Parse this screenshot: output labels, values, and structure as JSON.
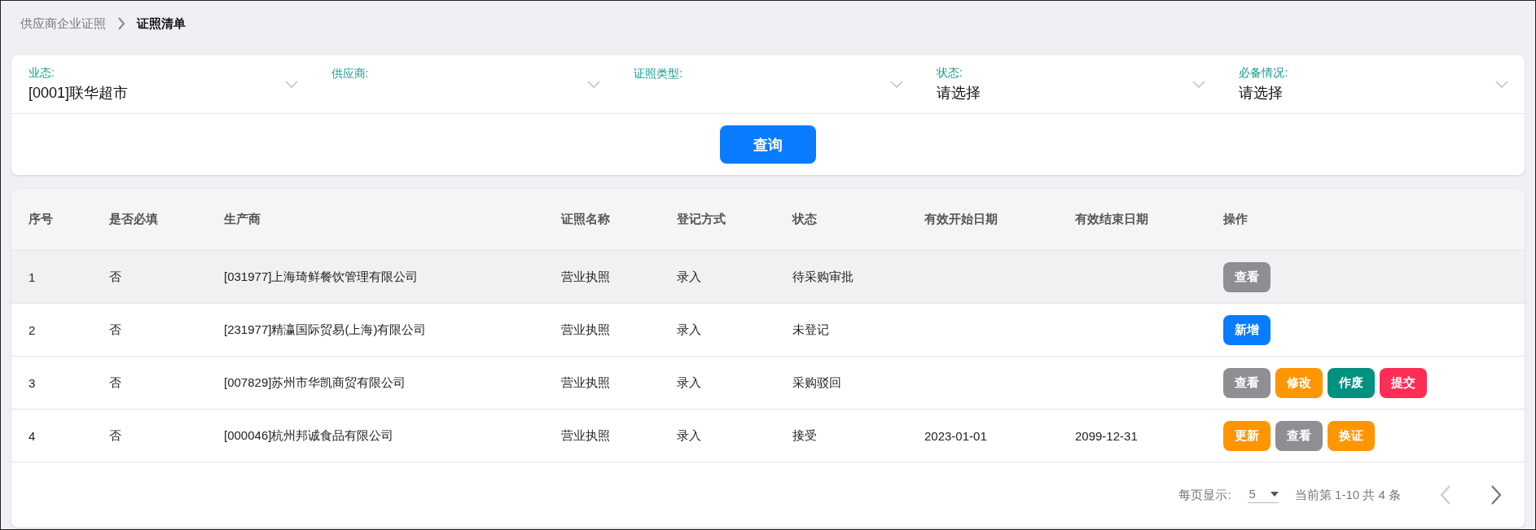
{
  "breadcrumb": [
    {
      "label": "供应商企业证照",
      "current": false
    },
    {
      "label": "证照清单",
      "current": true
    }
  ],
  "filters": [
    {
      "label": "业态:",
      "value": "[0001]联华超市"
    },
    {
      "label": "供应商:"
    },
    {
      "label": "证照类型:"
    },
    {
      "label": "状态:",
      "value": "请选择"
    },
    {
      "label": "必备情况:",
      "value": "请选择"
    }
  ],
  "query_button": "查询",
  "table": {
    "columns": [
      "序号",
      "是否必填",
      "生产商",
      "证照名称",
      "登记方式",
      "状态",
      "有效开始日期",
      "有效结束日期",
      "操作"
    ],
    "rows": [
      {
        "selected": true,
        "cells": [
          "1",
          "否",
          "[031977]上海琦鲜餐饮管理有限公司",
          "营业执照",
          "录入",
          "待采购审批",
          "",
          ""
        ],
        "actions": [
          {
            "label": "查看",
            "kind": "view"
          }
        ]
      },
      {
        "selected": false,
        "cells": [
          "2",
          "否",
          "[231977]精瀛国际贸易(上海)有限公司",
          "营业执照",
          "录入",
          "未登记",
          "",
          ""
        ],
        "actions": [
          {
            "label": "新增",
            "kind": "add"
          }
        ]
      },
      {
        "selected": false,
        "cells": [
          "3",
          "否",
          "[007829]苏州市华凯商贸有限公司",
          "营业执照",
          "录入",
          "采购驳回",
          "",
          ""
        ],
        "actions": [
          {
            "label": "查看",
            "kind": "view"
          },
          {
            "label": "修改",
            "kind": "edit"
          },
          {
            "label": "作废",
            "kind": "void"
          },
          {
            "label": "提交",
            "kind": "submit"
          }
        ]
      },
      {
        "selected": false,
        "cells": [
          "4",
          "否",
          "[000046]杭州邦诚食品有限公司",
          "营业执照",
          "录入",
          "接受",
          "2023-01-01",
          "2099-12-31"
        ],
        "actions": [
          {
            "label": "更新",
            "kind": "edit"
          },
          {
            "label": "查看",
            "kind": "view"
          },
          {
            "label": "换证",
            "kind": "edit"
          }
        ]
      }
    ]
  },
  "pagination": {
    "page_size_label": "每页显示:",
    "page_size": "5",
    "range": "当前第 1-10 共 4 条",
    "prev_disabled": true,
    "next_disabled": false
  }
}
